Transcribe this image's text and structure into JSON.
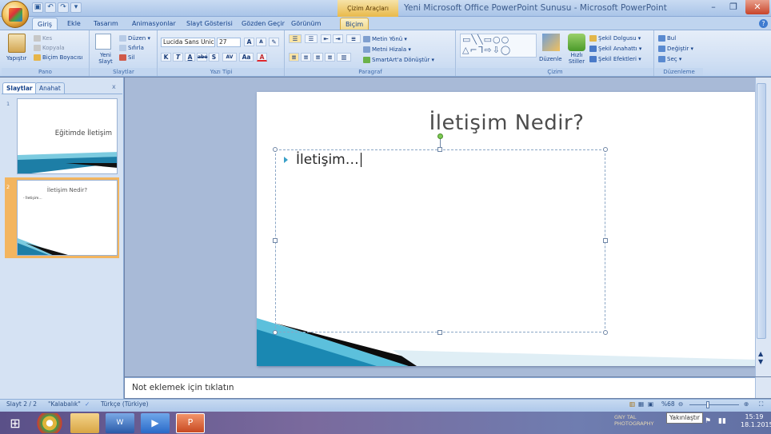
{
  "window": {
    "title": "Yeni Microsoft Office PowerPoint Sunusu - Microsoft PowerPoint",
    "context_tab_group": "Çizim Araçları"
  },
  "tabs": [
    "Giriş",
    "Ekle",
    "Tasarım",
    "Animasyonlar",
    "Slayt Gösterisi",
    "Gözden Geçir",
    "Görünüm",
    "Biçim"
  ],
  "ribbon": {
    "pano": {
      "label": "Pano",
      "paste": "Yapıştır",
      "cut": "Kes",
      "copy": "Kopyala",
      "format_painter": "Biçim Boyacısı"
    },
    "slaytlar": {
      "label": "Slaytlar",
      "new_slide": "Yeni Slayt",
      "layout": "Düzen",
      "reset": "Sıfırla",
      "delete": "Sil"
    },
    "yazitipi": {
      "label": "Yazı Tipi",
      "font": "Lucida Sans Unic",
      "size": "27",
      "bold": "K",
      "italic": "T",
      "underline": "A",
      "strike": "abe",
      "shadow": "S",
      "spacing": "AV",
      "case": "Aa",
      "color": "A"
    },
    "paragraf": {
      "label": "Paragraf",
      "text_direction": "Metin Yönü",
      "align_text": "Metni Hizala",
      "smartart": "SmartArt'a Dönüştür"
    },
    "cizim": {
      "label": "Çizim",
      "arrange": "Düzenle",
      "quick_styles": "Hızlı Stiller",
      "shape_fill": "Şekil Dolgusu",
      "shape_outline": "Şekil Anahattı",
      "shape_effects": "Şekil Efektleri"
    },
    "duzenleme": {
      "label": "Düzenleme",
      "find": "Bul",
      "replace": "Değiştir",
      "select": "Seç"
    }
  },
  "panel": {
    "tabs": [
      "Slaytlar",
      "Anahat"
    ],
    "close": "x"
  },
  "thumbnails": [
    {
      "num": "1",
      "title": "Eğitimde İletişim"
    },
    {
      "num": "2",
      "title": "İletişim Nedir?",
      "body": "- İletişim..."
    }
  ],
  "slide": {
    "title": "İletişim Nedir?",
    "bullet": "İletişim…"
  },
  "notes": {
    "placeholder": "Not eklemek için tıklatın"
  },
  "status": {
    "slide": "Slayt 2 / 2",
    "theme": "\"Kalabalık\"",
    "language": "Türkçe (Türkiye)",
    "zoom": "%68"
  },
  "tooltip": "Yakınlaştır",
  "watermark": "GNY TAL PHOTOGRAPHY",
  "clock": {
    "time": "15:19",
    "date": "18.1.2015"
  },
  "colors": {
    "accent": "#4bacc6",
    "ribbon": "#d3e1f4",
    "context": "#f1d88a"
  }
}
